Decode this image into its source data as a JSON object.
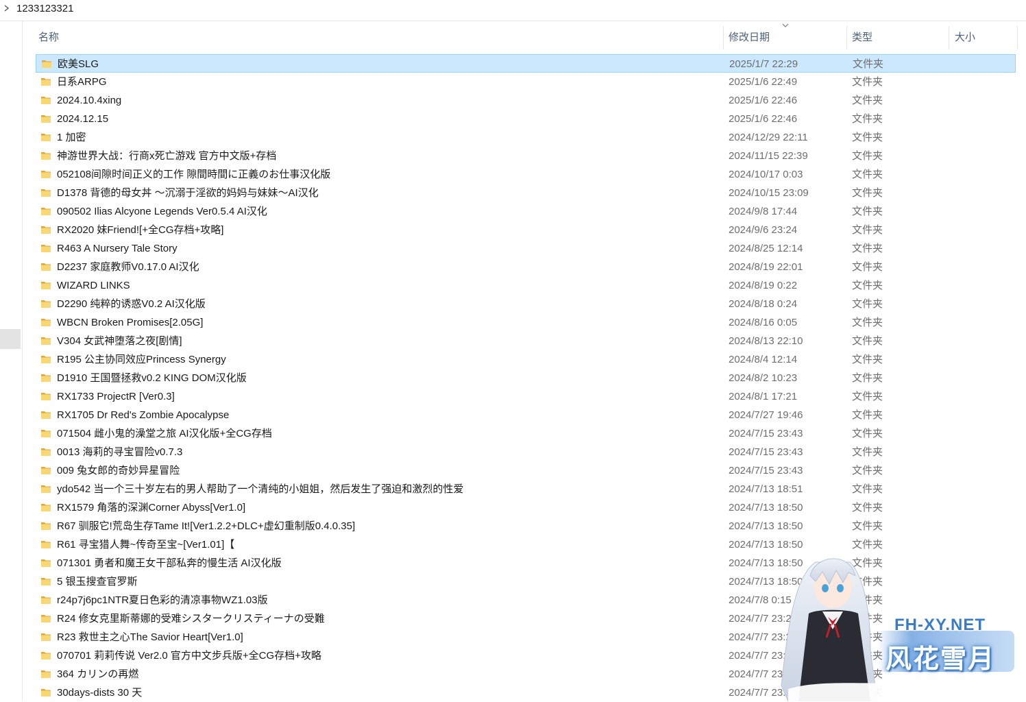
{
  "breadcrumb": {
    "path": "1233123321"
  },
  "columns": {
    "name": "名称",
    "modified": "修改日期",
    "type": "类型",
    "size": "大小"
  },
  "colors": {
    "selected_bg": "#cce8ff",
    "selected_border": "#99d1ff",
    "folder_yellow": "#f8d775",
    "folder_dark": "#e0a83a",
    "header_text": "#4c607a"
  },
  "selected_index": 0,
  "rows": [
    {
      "name": "欧美SLG",
      "date": "2025/1/7 22:29",
      "type": "文件夹"
    },
    {
      "name": "日系ARPG",
      "date": "2025/1/6 22:49",
      "type": "文件夹"
    },
    {
      "name": "2024.10.4xing",
      "date": "2025/1/6 22:46",
      "type": "文件夹"
    },
    {
      "name": "2024.12.15",
      "date": "2025/1/6 22:46",
      "type": "文件夹"
    },
    {
      "name": "1 加密",
      "date": "2024/12/29 22:11",
      "type": "文件夹"
    },
    {
      "name": "神游世界大战：行商x死亡游戏 官方中文版+存档",
      "date": "2024/11/15 22:39",
      "type": "文件夹"
    },
    {
      "name": "052108间隙时间正义的工作 隙間時間に正義のお仕事汉化版",
      "date": "2024/10/17 0:03",
      "type": "文件夹"
    },
    {
      "name": "D1378 背德的母女丼 ～沉溺于淫欲的妈妈与妹妹～AI汉化",
      "date": "2024/10/15 23:09",
      "type": "文件夹"
    },
    {
      "name": "090502 Ilias Alcyone Legends Ver0.5.4 AI汉化",
      "date": "2024/9/8 17:44",
      "type": "文件夹"
    },
    {
      "name": "RX2020 妹Friend![+全CG存档+攻略]",
      "date": "2024/9/6 23:24",
      "type": "文件夹"
    },
    {
      "name": "R463 A Nursery Tale Story",
      "date": "2024/8/25 12:14",
      "type": "文件夹"
    },
    {
      "name": "D2237 家庭教师V0.17.0 AI汉化",
      "date": "2024/8/19 22:01",
      "type": "文件夹"
    },
    {
      "name": "WIZARD LINKS",
      "date": "2024/8/19 0:22",
      "type": "文件夹"
    },
    {
      "name": "D2290 纯粹的诱惑V0.2 AI汉化版",
      "date": "2024/8/18 0:24",
      "type": "文件夹"
    },
    {
      "name": "WBCN Broken Promises[2.05G]",
      "date": "2024/8/16 0:05",
      "type": "文件夹"
    },
    {
      "name": "V304 女武神堕落之夜[剧情]",
      "date": "2024/8/13 22:10",
      "type": "文件夹"
    },
    {
      "name": "R195 公主协同效应Princess Synergy",
      "date": "2024/8/4 12:14",
      "type": "文件夹"
    },
    {
      "name": "D1910 王国暨拯救v0.2 KING DOM汉化版",
      "date": "2024/8/2 10:23",
      "type": "文件夹"
    },
    {
      "name": "RX1733 ProjectR [Ver0.3]",
      "date": "2024/8/1 17:21",
      "type": "文件夹"
    },
    {
      "name": "RX1705 Dr Red's Zombie Apocalypse",
      "date": "2024/7/27 19:46",
      "type": "文件夹"
    },
    {
      "name": "071504 雌小鬼的澡堂之旅 AI汉化版+全CG存档",
      "date": "2024/7/15 23:43",
      "type": "文件夹"
    },
    {
      "name": "0013 海莉的寻宝冒险v0.7.3",
      "date": "2024/7/15 23:43",
      "type": "文件夹"
    },
    {
      "name": "009 兔女郎的奇妙异星冒险",
      "date": "2024/7/15 23:43",
      "type": "文件夹"
    },
    {
      "name": "ydo542 当一个三十岁左右的男人帮助了一个清纯的小姐姐，然后发生了强迫和激烈的性爱",
      "date": "2024/7/13 18:51",
      "type": "文件夹"
    },
    {
      "name": "RX1579 角落的深渊Corner Abyss[Ver1.0]",
      "date": "2024/7/13 18:50",
      "type": "文件夹"
    },
    {
      "name": "R67 驯服它!荒岛生存Tame It![Ver1.2.2+DLC+虚幻重制版0.4.0.35]",
      "date": "2024/7/13 18:50",
      "type": "文件夹"
    },
    {
      "name": "R61 寻宝猎人舞~传奇至宝~[Ver1.01]【",
      "date": "2024/7/13 18:50",
      "type": "文件夹"
    },
    {
      "name": "071301 勇者和魔王女干部私奔的慢生活 AI汉化版",
      "date": "2024/7/13 18:50",
      "type": "文件夹"
    },
    {
      "name": "5 银玉搜查官罗斯",
      "date": "2024/7/13 18:50",
      "type": "文件夹"
    },
    {
      "name": "r24p7j6pc1NTR夏日色彩的清凉事物WZ1.03版",
      "date": "2024/7/8 0:15",
      "type": "文件夹"
    },
    {
      "name": "R24 修女克里斯蒂娜的受难シスタークリスティーナの受難",
      "date": "2024/7/7 23:2",
      "type": "文件夹"
    },
    {
      "name": "R23 救世主之心The Savior Heart[Ver1.0]",
      "date": "2024/7/7 23:2",
      "type": "文件夹"
    },
    {
      "name": "070701 莉莉传说 Ver2.0 官方中文步兵版+全CG存档+攻略",
      "date": "2024/7/7 23:",
      "type": "文件夹"
    },
    {
      "name": "364 カリンの再燃",
      "date": "2024/7/7 23:18",
      "type": "文件夹"
    },
    {
      "name": "30days-dists 30 天",
      "date": "2024/7/7 23:18",
      "type": "文件夹"
    }
  ],
  "watermark": {
    "domain": "FH-XY.NET",
    "brand": "风花雪月"
  }
}
